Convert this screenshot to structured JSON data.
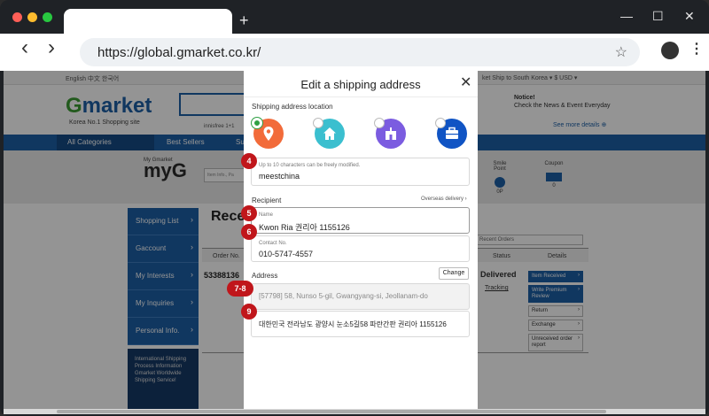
{
  "browser": {
    "url": "https://global.gmarket.co.kr/",
    "new_tab_label": "+",
    "back_glyph": "‹",
    "forward_glyph": "›",
    "minimize_glyph": "—",
    "maximize_glyph": "☐",
    "close_glyph": "✕",
    "star_glyph": "☆",
    "menu_glyph": "⋮",
    "traffic_lights": [
      "#ff5f57",
      "#febc2e",
      "#28c840"
    ]
  },
  "site": {
    "lang_links": "English   中文   한국어",
    "top_right": "ket   Ship to  South Korea ▾   $ USD ▾",
    "logo_g": "G",
    "logo_rest": "market",
    "logo_tagline": "Korea No.1 Shopping site",
    "search_hint": "innisfree 1+1",
    "notice_title": "Notice!",
    "notice_text": "Check the News & Event Everyday",
    "see_more": "See more details ⊕",
    "all_categories": "All Categories",
    "best_sellers": "Best Sellers",
    "su": "Su",
    "my_gmarket_small": "My Gmarket",
    "my_g": "myG",
    "item_search_placeholder": "Item Info., Pa",
    "smile_point_label": "Smile Point",
    "smile_point_value": "0P",
    "coupon_label": "Coupon",
    "coupon_value": "0",
    "side_menu": [
      "Shopping List",
      "Gaccount",
      "My Interests",
      "My Inquiries",
      "Personal Info."
    ],
    "intl_box": "International Shipping Process Information  Gmarket Worldwide Shipping Service!",
    "section_title": "Rece",
    "recent_orders_select": "Recent Orders",
    "col_order": "Order No.",
    "col_status": "Status",
    "col_details": "Details",
    "order_number": "53388136",
    "status": "Delivered",
    "tracking": "Tracking",
    "actions": [
      "Item Received",
      "Write Premium Review",
      "Return",
      "Exchange",
      "Unreceived order report"
    ]
  },
  "modal": {
    "title": "Edit a shipping address",
    "close_glyph": "✕",
    "location_label": "Shipping address location",
    "locations": [
      {
        "name": "pin",
        "color": "#f26b3a",
        "selected": true
      },
      {
        "name": "home",
        "color": "#3bbfcf",
        "selected": false
      },
      {
        "name": "office-building",
        "color": "#7b5ce0",
        "selected": false
      },
      {
        "name": "briefcase",
        "color": "#1054c4",
        "selected": false
      }
    ],
    "nickname_hint": "Up to 10 characters can be freely modified.",
    "nickname_value": "meestchina",
    "recipient_label": "Recipient",
    "overseas_link": "Overseas delivery ›",
    "name_label": "Name",
    "name_value": "Kwon Ria 권리아 1155126",
    "contact_label": "Contact No.",
    "contact_value": "010-5747-4557",
    "address_label": "Address",
    "change_button": "Change",
    "address_line1": "[57798] 58, Nunso 5-gil, Gwangyang-si, Jeollanam-do",
    "address_line2": "대한민국 전라남도 광양시 눈소5길58 파란간판 권리아 1155126",
    "badges": [
      "4",
      "5",
      "6",
      "7-8",
      "9"
    ]
  }
}
